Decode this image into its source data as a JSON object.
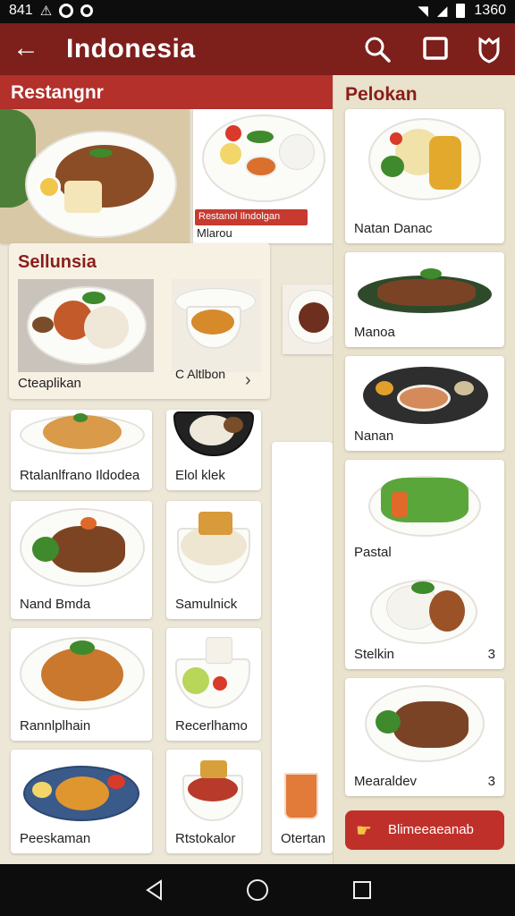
{
  "status": {
    "time_left": "841",
    "time_right": "1360"
  },
  "appbar": {
    "title": "Indonesia"
  },
  "sections": {
    "left_banner": "Restangnr",
    "right_title": "Pelokan",
    "overlay_title": "Sellunsia"
  },
  "cards": {
    "promo_badge": "Restanol Ilndolgan",
    "promo_caption": "Mlarou",
    "overlay_left": "Cteaplikan",
    "overlay_right": "C Altlbon",
    "row1_left": "Rtalanlfrano Ildodea",
    "row1_right": "Elol klek",
    "row2_left": "Nand Bmda",
    "row2_right": "Samulnick",
    "row3_left": "Rannlplhain",
    "row3_right": "Recerlhamo",
    "row4_left": "Peeskaman",
    "row4_right": "Rtstokalor",
    "drink": "Otertan"
  },
  "right_cards": [
    "Natan Danac",
    "Manoa",
    "Nanan",
    "Pastal",
    "Stelkin",
    "Mearaldev"
  ],
  "right_badges": {
    "stelkin": "3",
    "mearaldev": "3"
  },
  "cta": {
    "label": "Blimeeaeanab"
  },
  "icons": [
    "back-arrow-icon",
    "search-icon",
    "square-icon",
    "shield-icon",
    "hand-icon",
    "chevron-right-icon",
    "triangle-back-icon",
    "circle-home-icon",
    "square-recents-icon"
  ],
  "colors": {
    "appbar": "#7d1f1b",
    "banner": "#b3302b",
    "accent": "#c0302a"
  }
}
